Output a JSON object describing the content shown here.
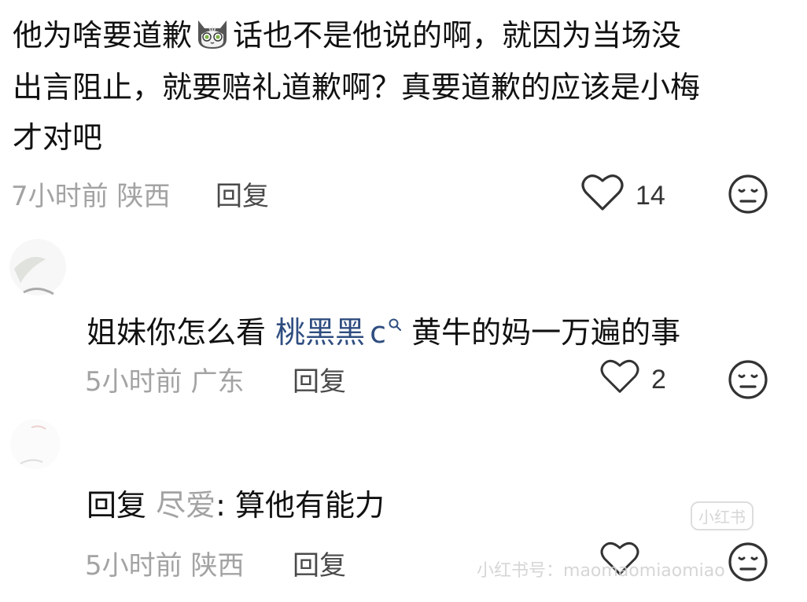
{
  "comments": [
    {
      "text_before_emoji": "他为啥要道歉",
      "emoji_icon": "cat-face-emoji-icon",
      "text_line1_after_emoji": "话也不是他说的啊，就因为当场没",
      "text_line2": "出言阻止，就要赔礼道歉啊？真要道歉的应该是小梅",
      "text_line3": "才对吧",
      "time": "7小时前",
      "location": "陕西",
      "reply_label": "回复",
      "likes": "14"
    },
    {
      "text_before_mention": "姐妹你怎么看",
      "mention_name": "桃黑黑",
      "mention_suffix": "c",
      "mention_icon": "search-small-icon",
      "text_after_mention": "黄牛的妈一万遍的事",
      "time": "5小时前",
      "location": "广东",
      "reply_label": "回复",
      "likes": "2"
    },
    {
      "reply_prefix": "回复",
      "reply_to_name": "尽爱",
      "reply_text": ": 算他有能力",
      "time": "5小时前",
      "location": "陕西",
      "reply_label": "回复",
      "likes": ""
    }
  ],
  "watermark": {
    "app_text": "小红书号：",
    "id_text": "maomaomiaomiao",
    "badge_text": "小红书"
  },
  "colors": {
    "body_text": "#111111",
    "meta_text": "#a3a3a3",
    "mention": "#2f4d80"
  }
}
